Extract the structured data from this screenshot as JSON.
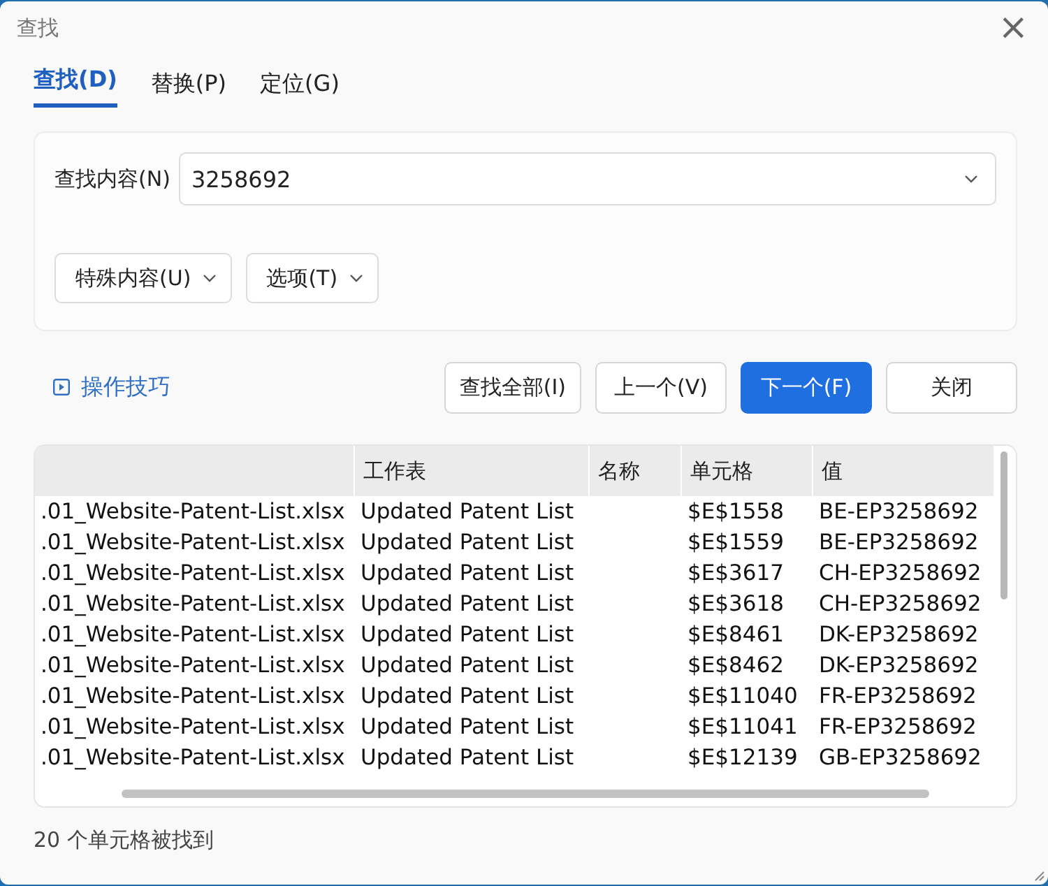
{
  "window": {
    "title": "查找",
    "close": "×"
  },
  "tabs": [
    {
      "label": "查找(D)",
      "selected": true
    },
    {
      "label": "替换(P)",
      "selected": false
    },
    {
      "label": "定位(G)",
      "selected": false
    }
  ],
  "search": {
    "label": "查找内容(N)",
    "value": "3258692"
  },
  "option_buttons": [
    "特殊内容(U)",
    "选项(T)"
  ],
  "tips_link": "操作技巧",
  "buttons": [
    {
      "label": "查找全部(I)",
      "primary": false
    },
    {
      "label": "上一个(V)",
      "primary": false
    },
    {
      "label": "下一个(F)",
      "primary": true
    },
    {
      "label": "关闭",
      "primary": false
    }
  ],
  "table": {
    "columns": [
      "工作表",
      "名称",
      "单元格",
      "值"
    ],
    "rows": [
      {
        "column_1": ".01_Website-Patent-List.xlsx",
        "sheet": "Updated Patent List",
        "cell": "$E$1558",
        "value": "BE-EP3258692"
      },
      {
        "column_1": ".01_Website-Patent-List.xlsx",
        "sheet": "Updated Patent List",
        "cell": "$E$1559",
        "value": "BE-EP3258692"
      },
      {
        "column_1": ".01_Website-Patent-List.xlsx",
        "sheet": "Updated Patent List",
        "cell": "$E$3617",
        "value": "CH-EP3258692"
      },
      {
        "column_1": ".01_Website-Patent-List.xlsx",
        "sheet": "Updated Patent List",
        "cell": "$E$3618",
        "value": "CH-EP3258692"
      },
      {
        "column_1": ".01_Website-Patent-List.xlsx",
        "sheet": "Updated Patent List",
        "cell": "$E$8461",
        "value": "DK-EP3258692"
      },
      {
        "column_1": ".01_Website-Patent-List.xlsx",
        "sheet": "Updated Patent List",
        "cell": "$E$8462",
        "value": "DK-EP3258692"
      },
      {
        "column_1": ".01_Website-Patent-List.xlsx",
        "sheet": "Updated Patent List",
        "cell": "$E$11040",
        "value": "FR-EP3258692"
      },
      {
        "column_1": ".01_Website-Patent-List.xlsx",
        "sheet": "Updated Patent List",
        "cell": "$E$11041",
        "value": "FR-EP3258692"
      },
      {
        "column_1": ".01_Website-Patent-List.xlsx",
        "sheet": "Updated Patent List",
        "cell": "$E$12139",
        "value": "GB-EP3258692"
      }
    ]
  },
  "status_bar": "20 个单元格被找到"
}
